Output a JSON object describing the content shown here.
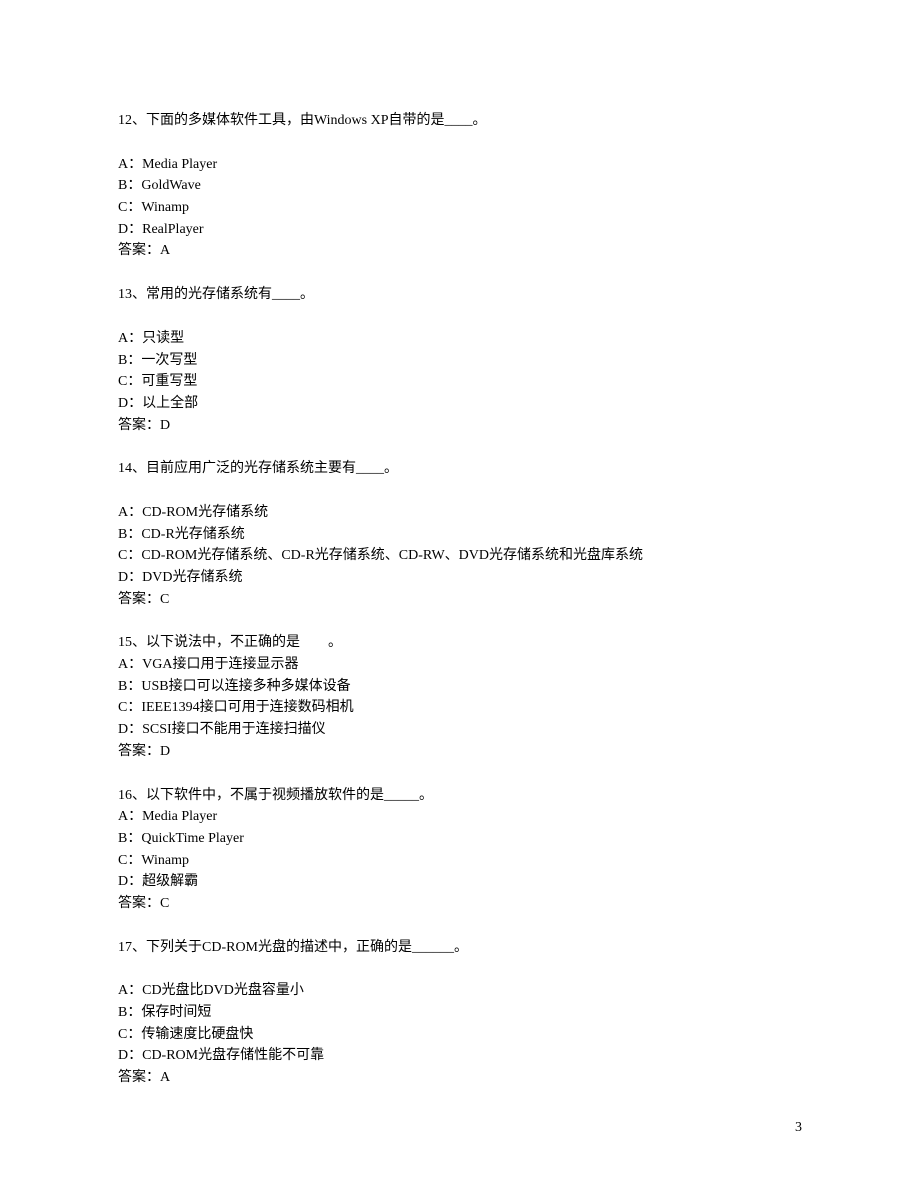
{
  "questions": [
    {
      "q": "12、下面的多媒体软件工具，由Windows XP自带的是____。",
      "q_tight": false,
      "opts": [
        "A：Media Player",
        "B：GoldWave",
        "C：Winamp",
        "D：RealPlayer"
      ],
      "answer": "答案：A"
    },
    {
      "q": "13、常用的光存储系统有____。",
      "q_tight": false,
      "opts": [
        "A：只读型",
        "B：一次写型",
        "C：可重写型",
        "D：以上全部"
      ],
      "answer": "答案：D"
    },
    {
      "q": "14、目前应用广泛的光存储系统主要有____。",
      "q_tight": false,
      "opts": [
        "A：CD-ROM光存储系统",
        "B：CD-R光存储系统",
        "C：CD-ROM光存储系统、CD-R光存储系统、CD-RW、DVD光存储系统和光盘库系统",
        "D：DVD光存储系统"
      ],
      "answer": "答案：C"
    },
    {
      "q": "15、以下说法中，不正确的是　　。",
      "q_tight": true,
      "opts": [
        "A：VGA接口用于连接显示器",
        "B：USB接口可以连接多种多媒体设备",
        "C：IEEE1394接口可用于连接数码相机",
        "D：SCSI接口不能用于连接扫描仪"
      ],
      "answer": "答案：D"
    },
    {
      "q": "16、以下软件中，不属于视频播放软件的是_____。",
      "q_tight": true,
      "opts": [
        "A：Media Player",
        "B：QuickTime Player",
        "C：Winamp",
        "D：超级解霸"
      ],
      "answer": "答案：C"
    },
    {
      "q": "17、下列关于CD-ROM光盘的描述中，正确的是______。",
      "q_tight": false,
      "opts": [
        "A：CD光盘比DVD光盘容量小",
        "B：保存时间短",
        "C：传输速度比硬盘快",
        "D：CD-ROM光盘存储性能不可靠"
      ],
      "answer": "答案：A"
    }
  ],
  "page_number": "3"
}
